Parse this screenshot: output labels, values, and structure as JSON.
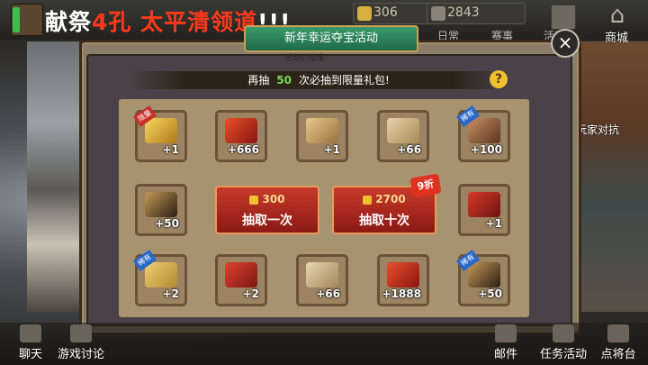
{
  "top": {
    "banner_prefix": "献祭",
    "banner_highlight": "4孔",
    "banner_suffix": "太平清领道",
    "banner_end": "!!!",
    "resource1": "306",
    "resource2": "2843",
    "shop": "商城",
    "nav_under1": "日常",
    "nav_under2": "赛事",
    "nav_under3": "活动"
  },
  "side": {
    "right_label": "玩家对抗"
  },
  "panel": {
    "title": "新年幸运夺宝活动",
    "subtitle": "活动已结束",
    "notice_pre": "再抽",
    "notice_num": "50",
    "notice_post": "次必抽到限量礼包!",
    "help": "?",
    "close": "×"
  },
  "items": [
    {
      "qty": "+1",
      "tag": "限量",
      "tag_color": "red",
      "icon": "gold-chest-icon"
    },
    {
      "qty": "+666",
      "tag": "",
      "tag_color": "",
      "icon": "red-gem-icon"
    },
    {
      "qty": "+1",
      "tag": "",
      "tag_color": "",
      "icon": "money-bag-icon"
    },
    {
      "qty": "+66",
      "tag": "",
      "tag_color": "",
      "icon": "scroll-map-icon"
    },
    {
      "qty": "+100",
      "tag": "稀有",
      "tag_color": "blue",
      "icon": "general-cards-icon"
    },
    {
      "qty": "+50",
      "tag": "",
      "tag_color": "",
      "icon": "silhouette-cards-icon"
    },
    {
      "qty": "+1",
      "tag": "",
      "tag_color": "",
      "icon": "red-bag-icon"
    },
    {
      "qty": "+2",
      "tag": "稀有",
      "tag_color": "blue",
      "icon": "free-ticket-icon"
    },
    {
      "qty": "+2",
      "tag": "",
      "tag_color": "",
      "icon": "red-pouch-icon"
    },
    {
      "qty": "+66",
      "tag": "",
      "tag_color": "",
      "icon": "scroll-bundle-icon"
    },
    {
      "qty": "+1888",
      "tag": "",
      "tag_color": "",
      "icon": "red-gem-icon"
    },
    {
      "qty": "+50",
      "tag": "稀有",
      "tag_color": "blue",
      "icon": "silhouette-cards-icon"
    }
  ],
  "draw_once": {
    "cost": "300",
    "label": "抽取一次"
  },
  "draw_ten": {
    "cost": "2700",
    "label": "抽取十次",
    "discount": "9折"
  },
  "bottom": {
    "chat": "聊天",
    "forum": "游戏讨论",
    "mail": "邮件",
    "tasks": "任务活动",
    "generals": "点将台"
  }
}
